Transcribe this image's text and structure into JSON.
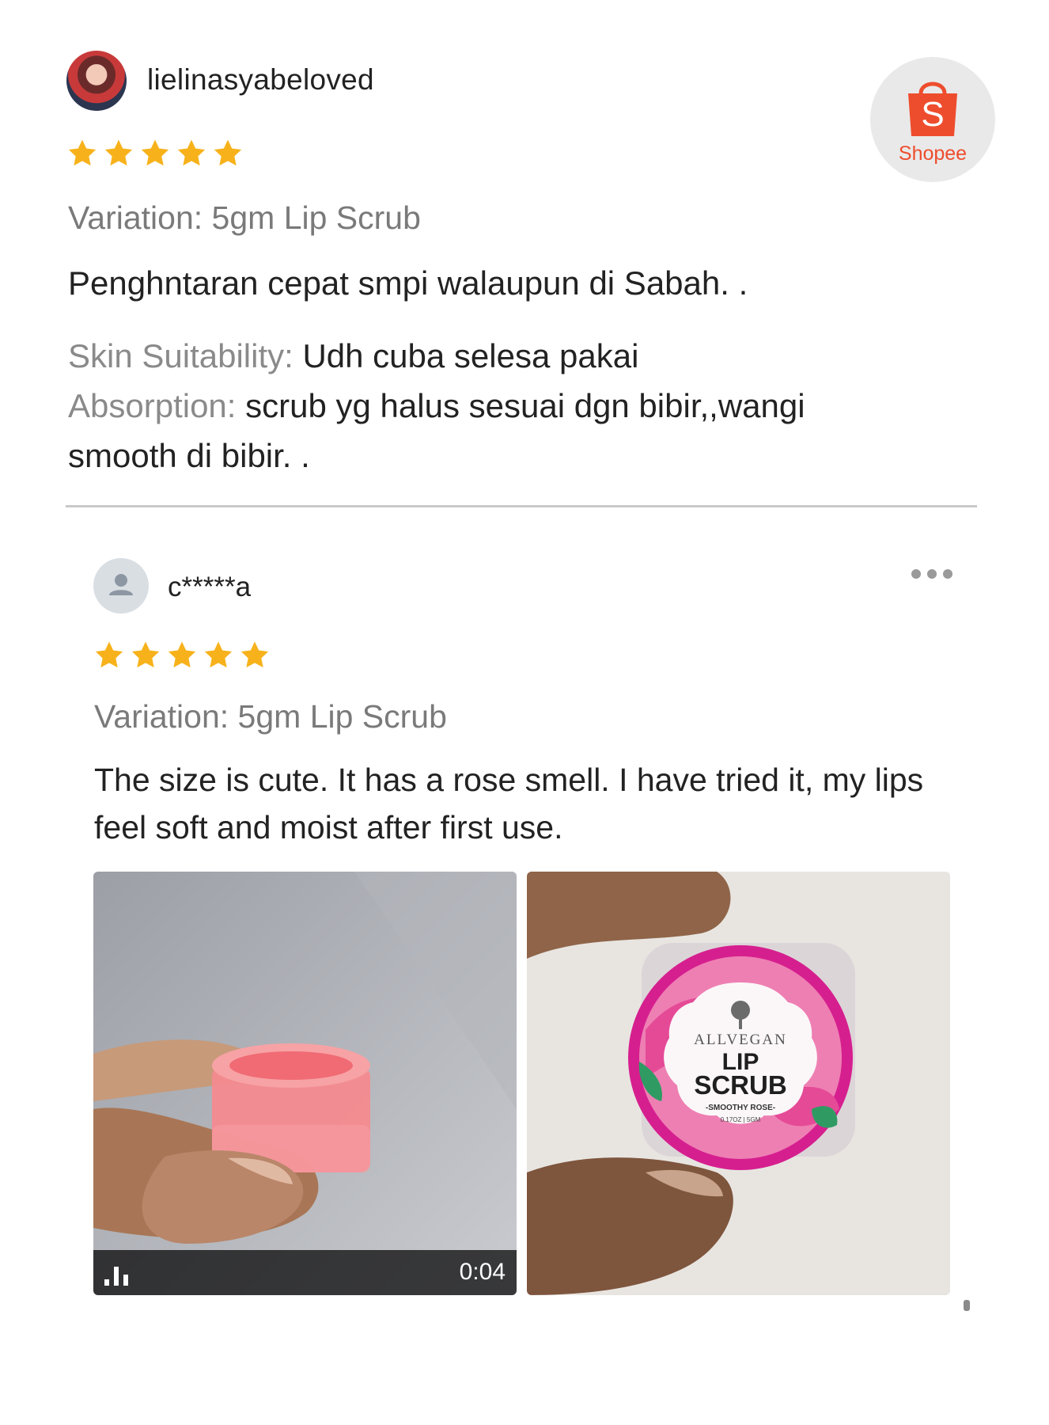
{
  "reviews": [
    {
      "username": "lielinasyabeloved",
      "rating": 5,
      "variation": "Variation: 5gm Lip Scrub",
      "comment": "Penghntaran cepat smpi walaupun di Sabah. .",
      "attributes": [
        {
          "label": "Skin Suitability:",
          "value": "Udh cuba selesa pakai"
        },
        {
          "label": "Absorption:",
          "value": "scrub yg halus sesuai dgn bibir,,wangi smooth di bibir. ."
        }
      ]
    },
    {
      "username": "c*****a",
      "rating": 5,
      "variation": "Variation: 5gm Lip Scrub",
      "comment": "The size is cute. It has a rose smell. I have tried it, my lips feel soft and moist after first use.",
      "video": {
        "duration": "0:04"
      },
      "product_label": {
        "brand": "ALLVEGAN",
        "line1": "LIP",
        "line2": "SCRUB",
        "variant": "-SMOOTHY ROSE-",
        "size": "0.17OZ | 5GM"
      }
    }
  ],
  "badge": {
    "brand": "Shopee",
    "letter": "S"
  },
  "colors": {
    "star": "#f7b21b",
    "shopee": "#ee4d2d",
    "label_gray": "#8a8a8a"
  },
  "icons": [
    "star-icon",
    "user-icon",
    "more-icon",
    "audio-bars-icon",
    "shopee-bag-icon"
  ]
}
